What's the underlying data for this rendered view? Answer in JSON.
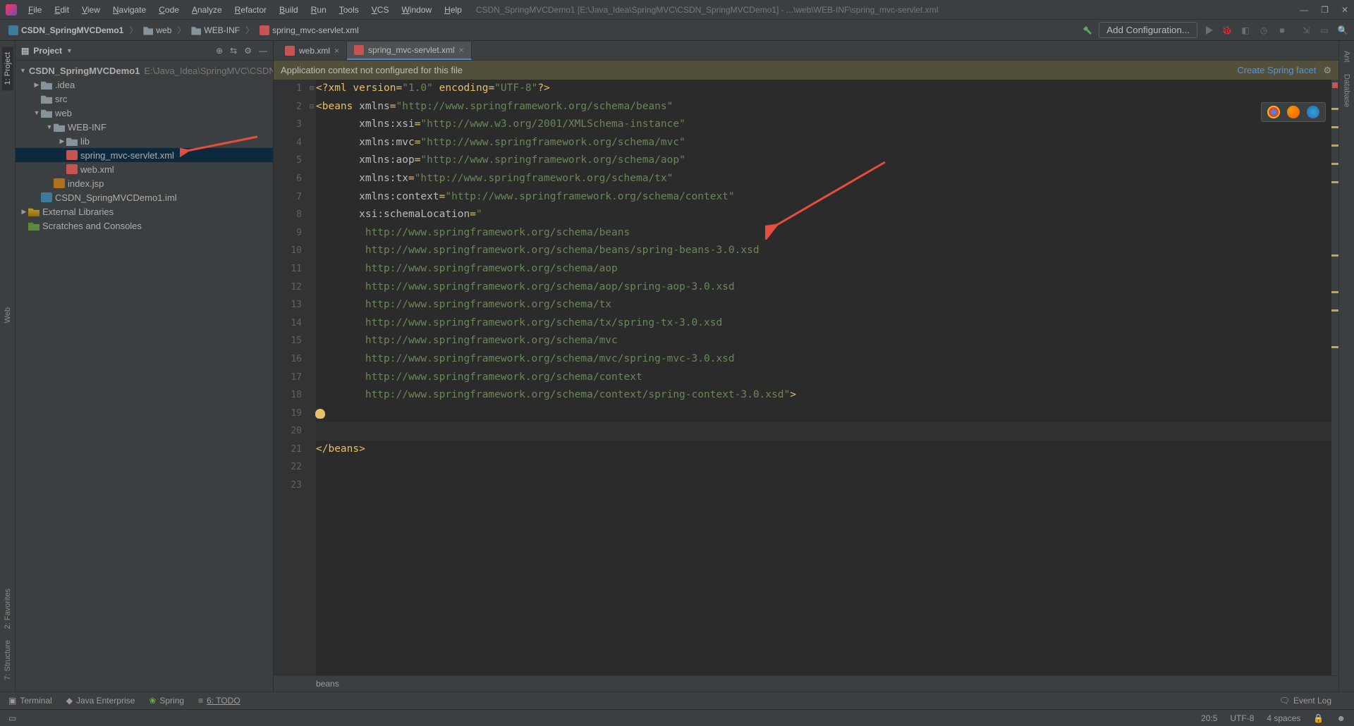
{
  "window": {
    "title": "CSDN_SpringMVCDemo1 [E:\\Java_Idea\\SpringMVC\\CSDN_SpringMVCDemo1] - ...\\web\\WEB-INF\\spring_mvc-servlet.xml"
  },
  "menu": [
    "File",
    "Edit",
    "View",
    "Navigate",
    "Code",
    "Analyze",
    "Refactor",
    "Build",
    "Run",
    "Tools",
    "VCS",
    "Window",
    "Help"
  ],
  "breadcrumbs": [
    {
      "icon": "module",
      "label": "CSDN_SpringMVCDemo1"
    },
    {
      "icon": "folder",
      "label": "web"
    },
    {
      "icon": "folder",
      "label": "WEB-INF"
    },
    {
      "icon": "xml",
      "label": "spring_mvc-servlet.xml"
    }
  ],
  "nav": {
    "add_config": "Add Configuration..."
  },
  "left_tabs": {
    "project": "1: Project",
    "web": "Web",
    "structure": "7: Structure",
    "favorites": "2: Favorites"
  },
  "right_tabs": {
    "ant": "Ant",
    "database": "Database"
  },
  "sidebar": {
    "title": "Project",
    "root": {
      "label": "CSDN_SpringMVCDemo1",
      "hint": "E:\\Java_Idea\\SpringMVC\\CSDN"
    },
    "items": [
      {
        "indent": 1,
        "arrow": "▶",
        "label": ".idea"
      },
      {
        "indent": 1,
        "arrow": "",
        "label": "src"
      },
      {
        "indent": 1,
        "arrow": "▼",
        "label": "web"
      },
      {
        "indent": 2,
        "arrow": "▼",
        "label": "WEB-INF"
      },
      {
        "indent": 3,
        "arrow": "▶",
        "label": "lib"
      },
      {
        "indent": 3,
        "arrow": "",
        "label": "spring_mvc-servlet.xml",
        "icon": "xml",
        "selected": true
      },
      {
        "indent": 3,
        "arrow": "",
        "label": "web.xml",
        "icon": "xml"
      },
      {
        "indent": 2,
        "arrow": "",
        "label": "index.jsp",
        "icon": "jsp"
      },
      {
        "indent": 1,
        "arrow": "",
        "label": "CSDN_SpringMVCDemo1.iml",
        "icon": "iml"
      }
    ],
    "external": "External Libraries",
    "scratches": "Scratches and Consoles"
  },
  "tabs": [
    {
      "label": "web.xml",
      "active": false
    },
    {
      "label": "spring_mvc-servlet.xml",
      "active": true
    }
  ],
  "notice": {
    "text": "Application context not configured for this file",
    "link": "Create Spring facet"
  },
  "code": {
    "lines": [
      {
        "n": 1,
        "html": "<span class='c-pi'>&lt;?</span><span class='c-tag'>xml version=</span><span class='c-str'>\"1.0\"</span> <span class='c-tag'>encoding=</span><span class='c-str'>\"UTF-8\"</span><span class='c-pi'>?&gt;</span>"
      },
      {
        "n": 2,
        "fold": "⊟",
        "html": "<span class='c-delim'>&lt;</span><span class='c-tag'>beans </span><span class='c-attr'>xmlns</span><span class='c-tag'>=</span><span class='c-str'>\"http://www.springframework.org/schema/beans\"</span>"
      },
      {
        "n": 3,
        "html": "       <span class='c-attr'>xmlns:xsi</span><span class='c-tag'>=</span><span class='c-str'>\"http://www.w3.org/2001/XMLSchema-instance\"</span>"
      },
      {
        "n": 4,
        "html": "       <span class='c-attr'>xmlns:mvc</span><span class='c-tag'>=</span><span class='c-str'>\"http://www.springframework.org/schema/mvc\"</span>"
      },
      {
        "n": 5,
        "html": "       <span class='c-attr'>xmlns:aop</span><span class='c-tag'>=</span><span class='c-str'>\"http://www.springframework.org/schema/aop\"</span>"
      },
      {
        "n": 6,
        "html": "       <span class='c-attr'>xmlns:tx</span><span class='c-tag'>=</span><span class='c-str'>\"http://www.springframework.org/schema/tx\"</span>"
      },
      {
        "n": 7,
        "html": "       <span class='c-attr'>xmlns:context</span><span class='c-tag'>=</span><span class='c-str'>\"http://www.springframework.org/schema/context\"</span>"
      },
      {
        "n": 8,
        "html": "       <span class='c-attr'>xsi:schemaLocation</span><span class='c-tag'>=</span><span class='c-str'>\"</span>"
      },
      {
        "n": 9,
        "html": "        <span class='c-str'>http://www.springframework.org/schema/beans</span>"
      },
      {
        "n": 10,
        "html": "        <span class='c-str'>http://www.springframework.org/schema/beans/spring-beans-3.0.xsd</span>"
      },
      {
        "n": 11,
        "html": "        <span class='c-str'>http://www.springframework.org/schema/aop</span>"
      },
      {
        "n": 12,
        "html": "        <span class='c-str'>http://www.springframework.org/schema/aop/spring-aop-3.0.xsd</span>"
      },
      {
        "n": 13,
        "html": "        <span class='c-str'>http://www.springframework.org/schema/tx</span>"
      },
      {
        "n": 14,
        "html": "        <span class='c-str'>http://www.springframework.org/schema/tx/spring-tx-3.0.xsd</span>"
      },
      {
        "n": 15,
        "html": "        <span class='c-str'>http://www.springframework.org/schema/mvc</span>"
      },
      {
        "n": 16,
        "html": "        <span class='c-str'>http://www.springframework.org/schema/mvc/spring-mvc-3.0.xsd</span>"
      },
      {
        "n": 17,
        "html": "        <span class='c-str'>http://www.springframework.org/schema/context</span>"
      },
      {
        "n": 18,
        "html": "        <span class='c-str'>http://www.springframework.org/schema/context/spring-context-3.0.xsd\"</span><span class='c-delim'>&gt;</span>"
      },
      {
        "n": 19,
        "html": ""
      },
      {
        "n": 20,
        "html": "    ",
        "caret": true
      },
      {
        "n": 21,
        "fold": "⊟",
        "html": "<span class='c-delim'>&lt;/</span><span class='c-tag'>beans</span><span class='c-delim'>&gt;</span>"
      },
      {
        "n": 22,
        "html": ""
      },
      {
        "n": 23,
        "html": ""
      }
    ],
    "breadcrumb": "beans"
  },
  "bottom": {
    "terminal": "Terminal",
    "java_ee": "Java Enterprise",
    "spring": "Spring",
    "todo": "6: TODO",
    "event_log": "Event Log"
  },
  "status": {
    "pos": "20:5",
    "enc": "UTF-8",
    "indent": "4 spaces"
  }
}
